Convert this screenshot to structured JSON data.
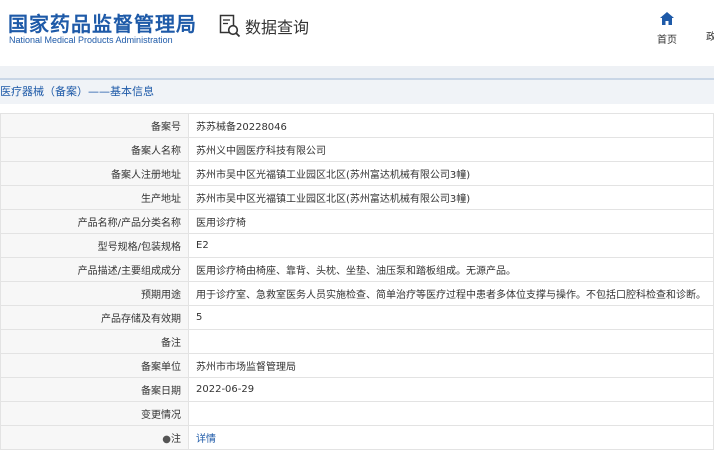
{
  "header": {
    "logo_cn": "国家药品监督管理局",
    "logo_en": "National Medical Products Administration",
    "query_title": "数据查询",
    "nav_home": "首页",
    "nav_more": "政"
  },
  "breadcrumb": "医疗器械（备案）——基本信息",
  "rows": [
    {
      "label": "备案号",
      "value": "苏苏械备20228046"
    },
    {
      "label": "备案人名称",
      "value": "苏州义中圆医疗科技有限公司"
    },
    {
      "label": "备案人注册地址",
      "value": "苏州市吴中区光福镇工业园区北区(苏州富达机械有限公司3幢)"
    },
    {
      "label": "生产地址",
      "value": "苏州市吴中区光福镇工业园区北区(苏州富达机械有限公司3幢)"
    },
    {
      "label": "产品名称/产品分类名称",
      "value": "医用诊疗椅"
    },
    {
      "label": "型号规格/包装规格",
      "value": "E2"
    },
    {
      "label": "产品描述/主要组成成分",
      "value": "医用诊疗椅由椅座、靠背、头枕、坐垫、油压泵和踏板组成。无源产品。"
    },
    {
      "label": "预期用途",
      "value": "用于诊疗室、急救室医务人员实施检查、简单治疗等医疗过程中患者多体位支撑与操作。不包括口腔科检查和诊断。"
    },
    {
      "label": "产品存储及有效期",
      "value": "5"
    },
    {
      "label": "备注",
      "value": ""
    },
    {
      "label": "备案单位",
      "value": "苏州市市场监督管理局"
    },
    {
      "label": "备案日期",
      "value": "2022-06-29"
    },
    {
      "label": "变更情况",
      "value": ""
    },
    {
      "label": "注",
      "value": "详情"
    }
  ],
  "colors": {
    "brand": "#1e5aa8"
  }
}
